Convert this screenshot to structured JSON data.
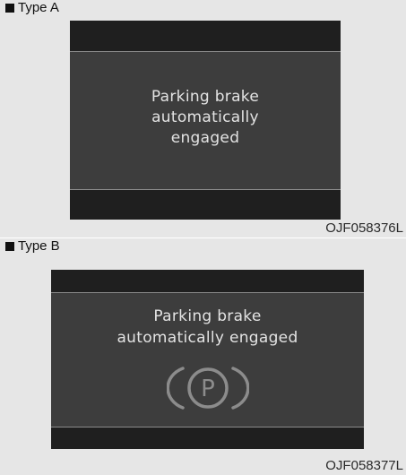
{
  "type_a": {
    "label": "Type A",
    "message_lines": [
      "Parking brake",
      "automatically",
      "engaged"
    ],
    "code": "OJF058376L"
  },
  "type_b": {
    "label": "Type B",
    "message_lines": [
      "Parking brake",
      "automatically engaged"
    ],
    "icon": "parking-brake-icon",
    "icon_letter": "P",
    "code": "OJF058377L"
  },
  "colors": {
    "panel_background": "#e6e6e6",
    "screen_background": "#3d3d3d",
    "screen_bar": "#1f1f1f",
    "screen_text": "#e3e3e3"
  }
}
